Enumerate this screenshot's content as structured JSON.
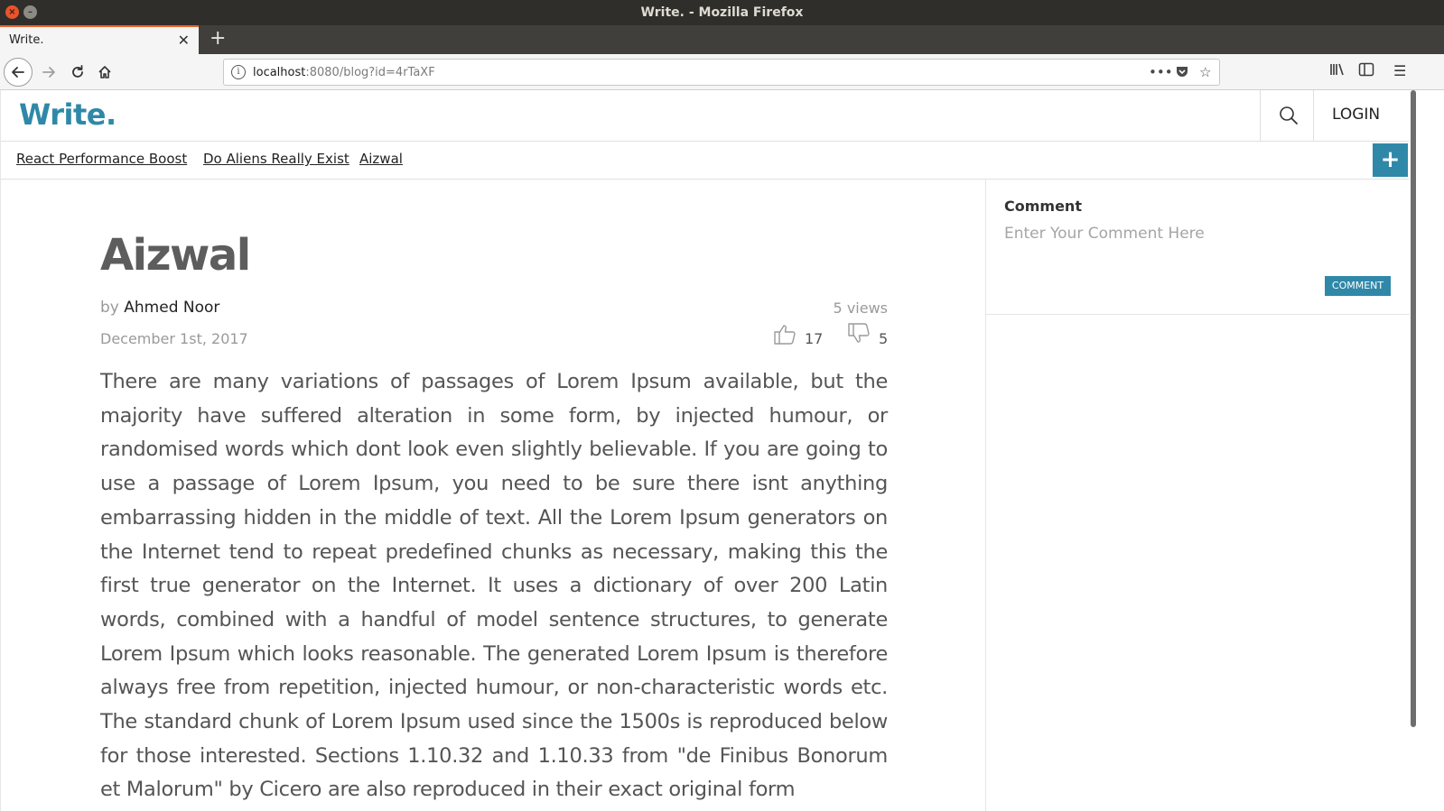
{
  "window": {
    "title": "Write. - Mozilla Firefox"
  },
  "browser": {
    "tab_title": "Write.",
    "url_host": "localhost",
    "url_rest": ":8080/blog?id=4rTaXF"
  },
  "site": {
    "logo": "Write.",
    "login_label": "LOGIN",
    "topics": [
      "React Performance Boost",
      "Do Aliens Really Exist",
      "Aizwal"
    ],
    "brand_color": "#2f88a8"
  },
  "article": {
    "title": "Aizwal",
    "by_label": "by",
    "author": "Ahmed Noor",
    "date": "December 1st, 2017",
    "views": "5 views",
    "likes": "17",
    "dislikes": "5",
    "body": "There are many variations of passages of Lorem Ipsum available, but the majority have suffered alteration in some form, by injected humour, or randomised words which dont look even slightly believable. If you are going to use a passage of Lorem Ipsum, you need to be sure there isnt anything embarrassing hidden in the middle of text. All the Lorem Ipsum generators on the Internet tend to repeat predefined chunks as necessary, making this the first true generator on the Internet. It uses a dictionary of over 200 Latin words, combined with a handful of model sentence structures, to generate Lorem Ipsum which looks reasonable. The generated Lorem Ipsum is therefore always free from repetition, injected humour, or non-characteristic words etc. The standard chunk of Lorem Ipsum used since the 1500s is reproduced below for those interested. Sections 1.10.32 and 1.10.33 from \"de Finibus Bonorum et Malorum\" by Cicero are also reproduced in their exact original form"
  },
  "comment": {
    "label": "Comment",
    "placeholder": "Enter Your Comment Here",
    "button": "COMMENT"
  }
}
